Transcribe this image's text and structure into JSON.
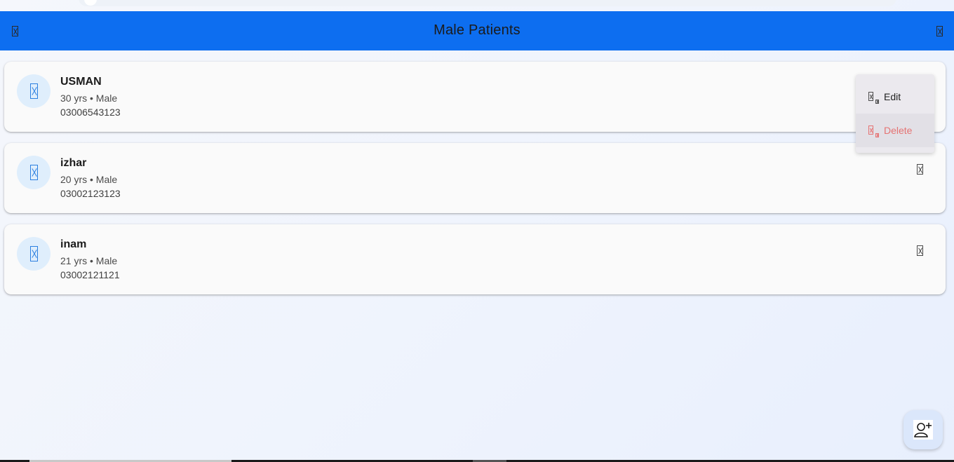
{
  "app_bar": {
    "title": "Male Patients",
    "menu_icon": "menu-icon",
    "action_icon": "action-icon",
    "background": "#0d6ef0"
  },
  "patients": [
    {
      "name": "USMAN",
      "meta": "30 yrs • Male",
      "phone": "03006543123"
    },
    {
      "name": "izhar",
      "meta": "20 yrs • Male",
      "phone": "03002123123"
    },
    {
      "name": "inam",
      "meta": "21 yrs • Male",
      "phone": "03002121121"
    }
  ],
  "popup_menu": {
    "edit_label": "Edit",
    "delete_label": "Delete",
    "delete_color": "#e57373"
  },
  "fab": {
    "icon": "add-person-icon"
  }
}
